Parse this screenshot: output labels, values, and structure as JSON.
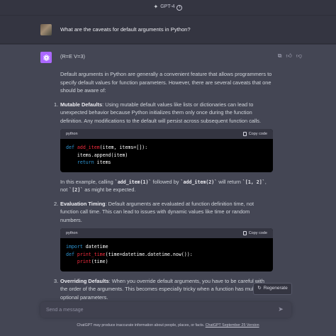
{
  "header": {
    "model": "GPT-4",
    "info_icon": "info-icon",
    "spark_icon": "sparkle-icon"
  },
  "user_message": {
    "text": "What are the caveats for default arguments in Python?"
  },
  "assistant": {
    "meta": "(R=E V=3)",
    "intro": "Default arguments in Python are generally a convenient feature that allows programmers to specify default values for function parameters. However, there are several caveats that one should be aware of:",
    "items": [
      {
        "num": "1.",
        "title": "Mutable Defaults",
        "text": ": Using mutable default values like lists or dictionaries can lead to unexpected behavior because Python initializes them only once during the function definition. Any modifications to the default will persist across subsequent function calls.",
        "code_lang": "python",
        "after_parts": [
          "In this example, calling ",
          "add_item(1)",
          " followed by ",
          "add_item(2)",
          " will return ",
          "[1, 2]",
          ", not ",
          "[2]",
          " as might be expected."
        ]
      },
      {
        "num": "2.",
        "title": "Evaluation Timing",
        "text": ": Default arguments are evaluated at function definition time, not function call time. This can lead to issues with dynamic values like time or random numbers.",
        "code_lang": "python"
      },
      {
        "num": "3.",
        "title": "Overriding Defaults",
        "text": ": When you override default arguments, you have to be careful with the order of the arguments. This becomes especially tricky when a function has multiple optional parameters."
      }
    ],
    "code1": {
      "l1_kw": "def",
      "l1_fn": "add_item",
      "l1_rest": "(item, items=[]):",
      "l2": "    items.append(item)",
      "l3_kw": "    return",
      "l3_rest": " items"
    },
    "code2": {
      "l1_kw": "import",
      "l1_rest": " datetime",
      "l2_kw": "def",
      "l2_fn": "print_time",
      "l2_rest": "(time=datetime.datetime.now()):",
      "l3_fn": "    print",
      "l3_rest": "(time)"
    },
    "copy_label": "Copy code"
  },
  "regenerate_label": "Regenerate",
  "input": {
    "placeholder": "Send a message"
  },
  "footer": {
    "text": "ChatGPT may produce inaccurate information about people, places, or facts. ",
    "link": "ChatGPT September 25 Version"
  },
  "colors": {
    "background": "#343541",
    "assistant_bg": "#444654",
    "gpt_avatar": "#ab68ff",
    "keyword": "#2e95d3",
    "function": "#f22c3d"
  }
}
